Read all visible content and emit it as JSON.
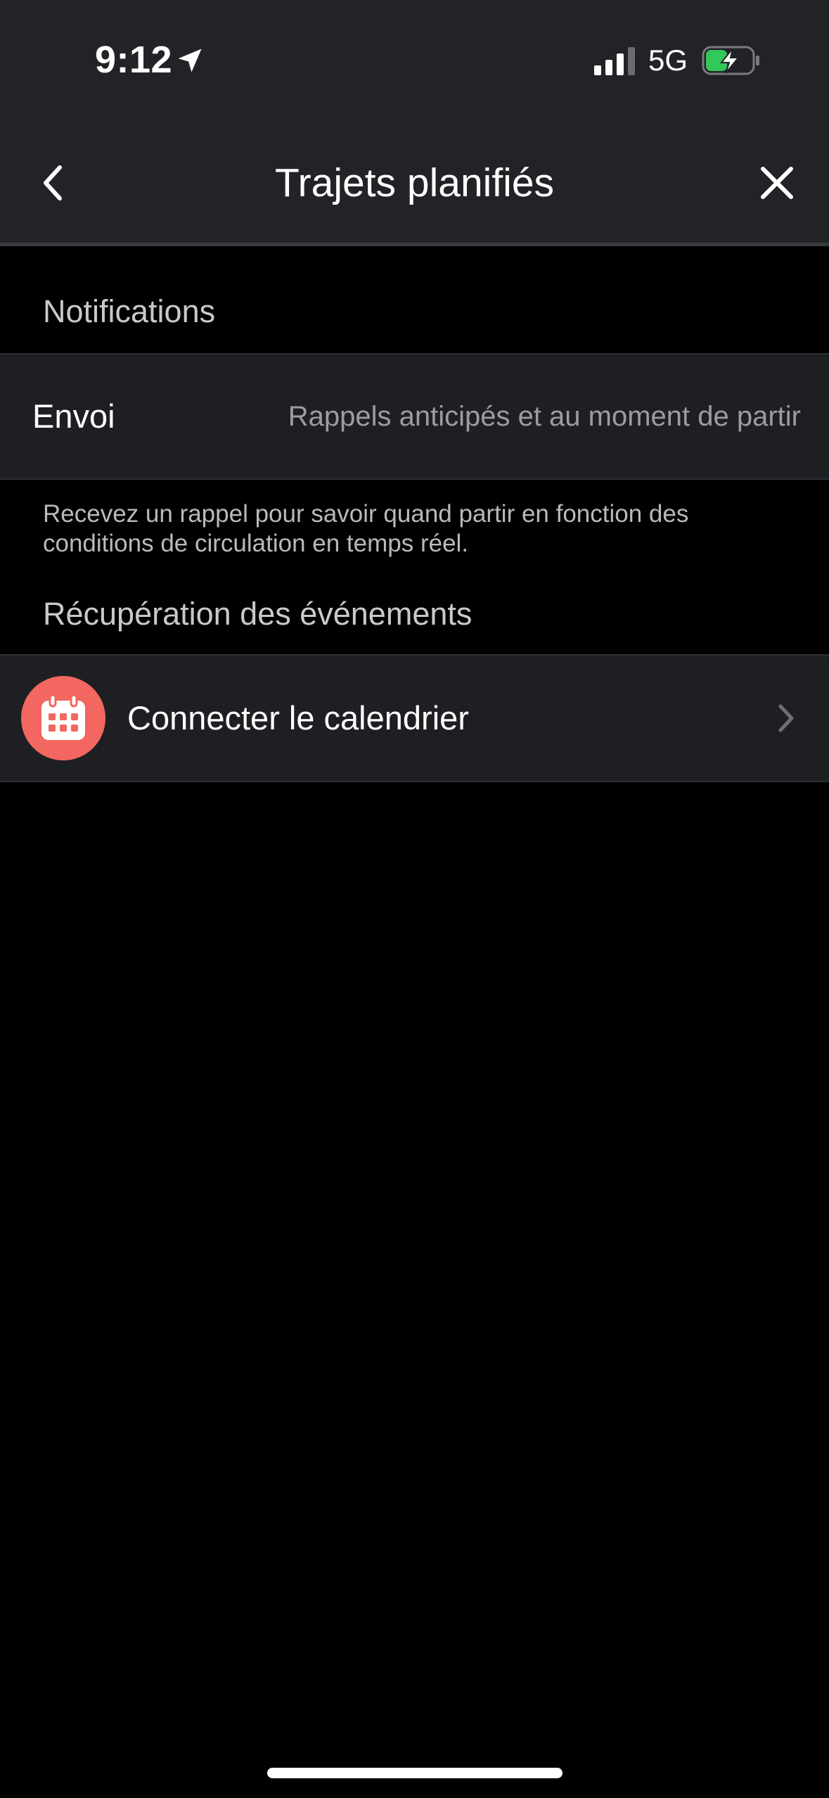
{
  "status_bar": {
    "time": "9:12",
    "network": "5G"
  },
  "nav": {
    "title": "Trajets planifiés"
  },
  "notifications_section": {
    "header": "Notifications",
    "row_label": "Envoi",
    "row_value": "Rappels anticipés et au moment de partir",
    "helper": "Recevez un rappel pour savoir quand partir en fonction des conditions de circulation en temps réel."
  },
  "events_section": {
    "header": "Récupération des événements",
    "row_label": "Connecter le calendrier"
  },
  "colors": {
    "header_bg": "#222327",
    "row_bg": "#1e1f23",
    "calendar_accent": "#f2675f",
    "battery_green": "#34c759"
  },
  "icons": [
    "location-arrow-icon",
    "signal-icon",
    "battery-charging-icon",
    "chevron-left-icon",
    "close-icon",
    "calendar-icon",
    "chevron-right-icon"
  ]
}
